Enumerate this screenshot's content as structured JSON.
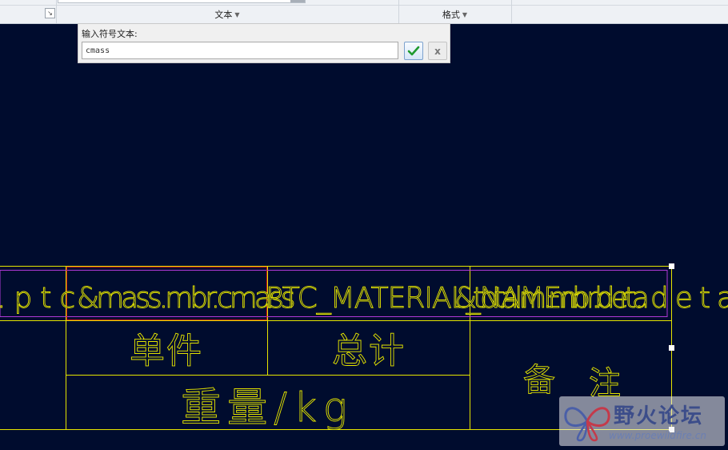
{
  "ribbon": {
    "groups": [
      {
        "label": "文本"
      },
      {
        "label": "格式"
      }
    ]
  },
  "dialog": {
    "label": "输入符号文本:",
    "input_value": "cmass",
    "ok_icon": "checkmark-icon",
    "cancel_icon": "close-icon",
    "cancel_glyph": "x"
  },
  "table": {
    "header_row": {
      "left_fragment": ".ptc",
      "overlap_1": "&mass.mbr.cmass",
      "overlap_2": "PTC_MATERIAL_NAME",
      "overlap_3": "&totalm.mbr.deta",
      "right_fragment": "mbr.deta"
    },
    "cells": {
      "unit": "单件",
      "total": "总计",
      "weight": "重量/kg",
      "remarks_1": "备",
      "remarks_2": "注"
    }
  },
  "colors": {
    "background": "#000c2e",
    "lines": "#e5e500",
    "selection_red": "#cc1a1a",
    "selection_magenta": "#b03ad8",
    "handle": "#ffffff"
  },
  "watermark": {
    "title": "野火论坛",
    "url": "www.proewildfire.cn"
  }
}
